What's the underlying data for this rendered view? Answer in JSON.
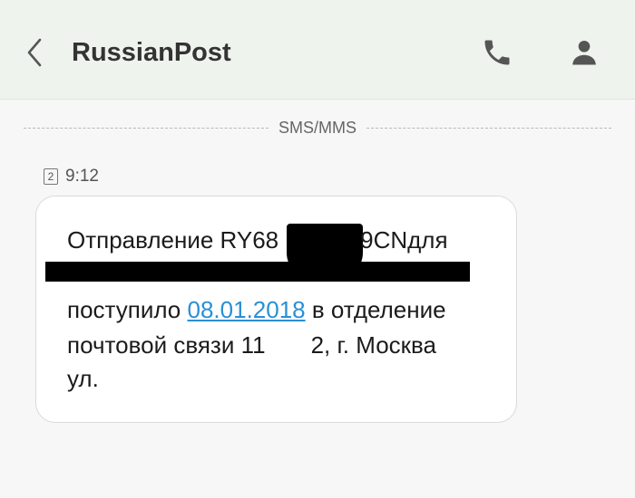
{
  "header": {
    "title": "RussianPost"
  },
  "divider": {
    "label": "SMS/MMS"
  },
  "message": {
    "sim_slot": "2",
    "time": "9:12",
    "line1_prefix": "Отправление RY68",
    "line1_suffix": "9CNдля",
    "line2_prefix": "поступило ",
    "date_link": "08.01.2018",
    "line2_suffix": " в отделение",
    "line3_prefix": "почтовой связи 11",
    "line3_suffix": "2, г. Москва",
    "line4": "ул."
  },
  "colors": {
    "header_bg": "#eef3ee",
    "page_bg": "#f7f7f7",
    "link": "#2a8fd6",
    "bubble_bg": "#ffffff"
  }
}
